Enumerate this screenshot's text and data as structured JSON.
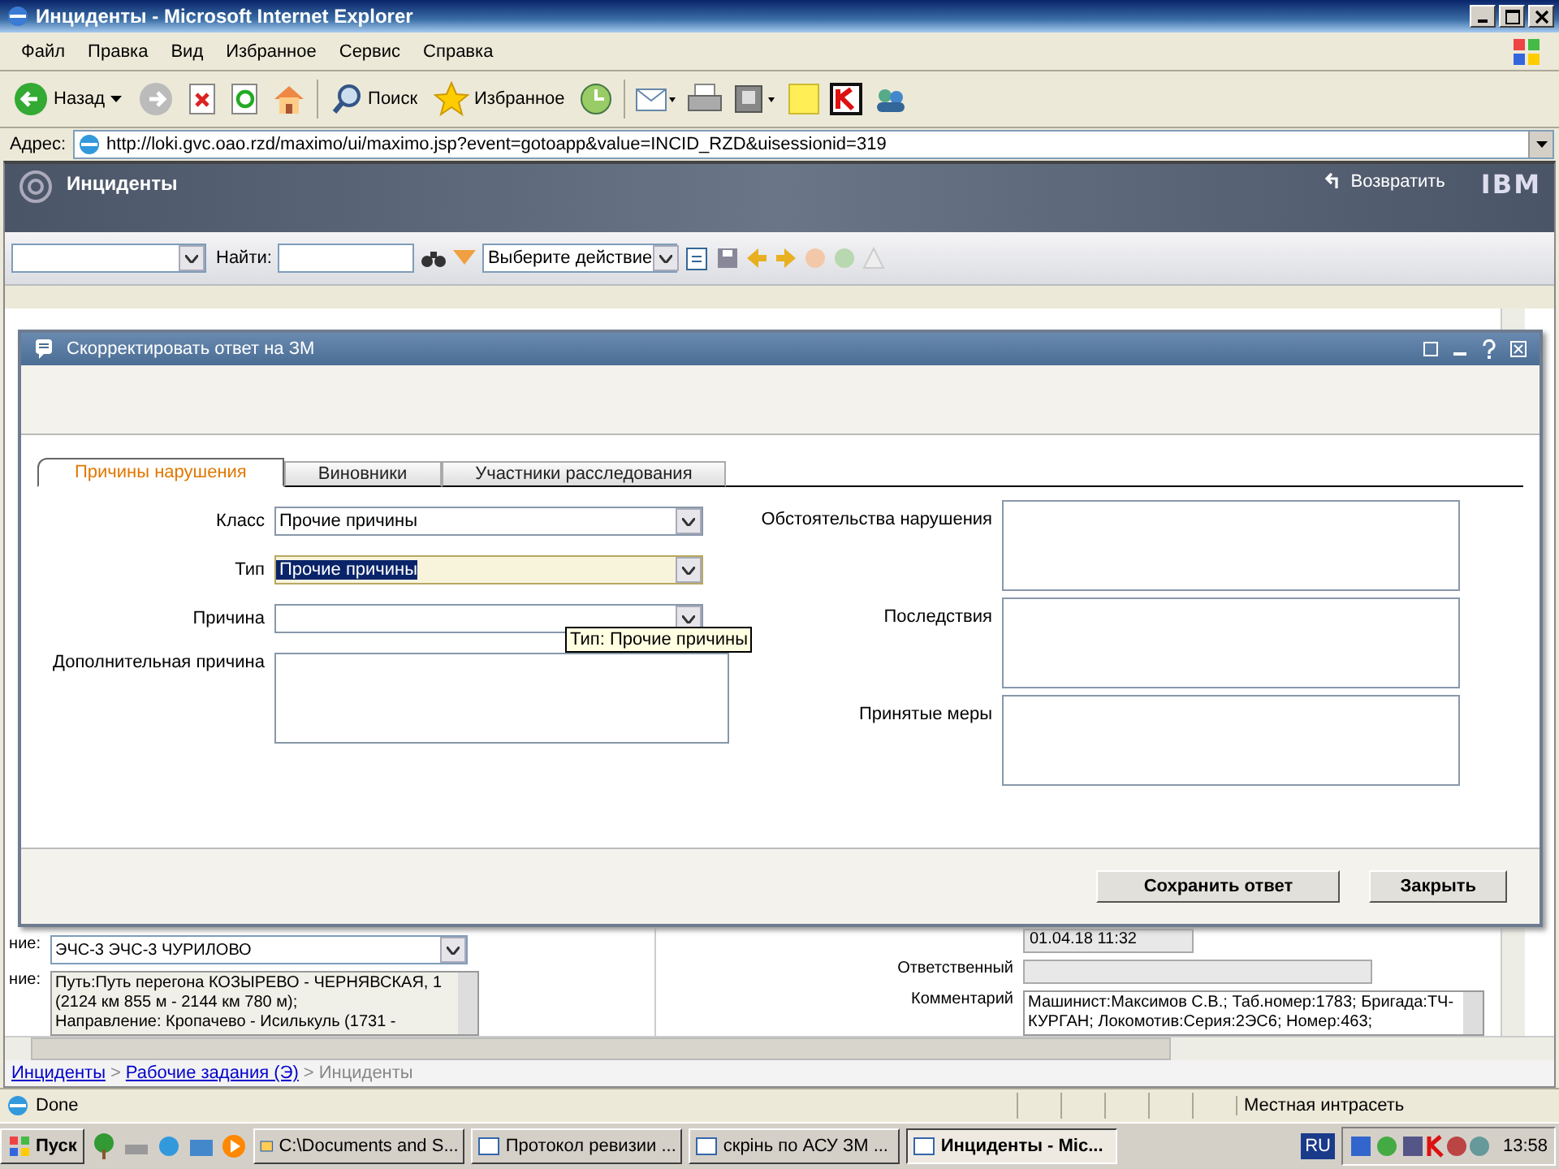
{
  "window": {
    "title": "Инциденты - Microsoft Internet Explorer"
  },
  "menu": [
    "Файл",
    "Правка",
    "Вид",
    "Избранное",
    "Сервис",
    "Справка"
  ],
  "toolbar": {
    "back": "Назад",
    "search": "Поиск",
    "favorites": "Избранное"
  },
  "address": {
    "label": "Адрес:",
    "url": "http://loki.gvc.oao.rzd/maximo/ui/maximo.jsp?event=gotoapp&value=INCID_RZD&uisessionid=319"
  },
  "app": {
    "title": "Инциденты",
    "return_link": "Возвратить",
    "logo": "IBM",
    "find_label": "Найти:",
    "action_select": "Выберите действие"
  },
  "dialog": {
    "title": "Скорректировать ответ на ЗМ",
    "tabs": [
      {
        "label": "Причины нарушения",
        "selected": true
      },
      {
        "label": "Виновники",
        "selected": false
      },
      {
        "label": "Участники расследования",
        "selected": false
      }
    ],
    "left_fields": [
      {
        "label": "Класс",
        "kind": "select",
        "value": "Прочие причины",
        "highlighted": false
      },
      {
        "label": "Тип",
        "kind": "select",
        "value": "Прочие причины",
        "highlighted": true
      },
      {
        "label": "Причина",
        "kind": "select",
        "highlighted": false
      },
      {
        "label": "Дополнительная причина",
        "kind": "textarea"
      }
    ],
    "right_fields": [
      {
        "label": "Обстоятельства нарушения"
      },
      {
        "label": "Последствия"
      },
      {
        "label": "Принятые меры"
      }
    ],
    "tooltip": "Тип: Прочие причины",
    "buttons": [
      "Сохранить ответ",
      "Закрыть"
    ]
  },
  "background": {
    "left": [
      {
        "label": "ние:",
        "kind": "select",
        "value": "ЭЧС-3 ЭЧС-3 ЧУРИЛОВО"
      },
      {
        "label": "ние:",
        "kind": "textarea",
        "lines": [
          "Путь:Путь перегона КОЗЫРЕВО - ЧЕРНЯВСКАЯ, 1",
          "(2124 км 855 м - 2144 км 780 м);",
          "Направление: Кропачево - Исилькуль (1731 -"
        ]
      }
    ],
    "right": [
      {
        "kind": "readonly",
        "value": "01.04.18 11:32"
      },
      {
        "label": "Ответственный",
        "kind": "readonly"
      },
      {
        "label": "Комментарий",
        "kind": "textarea",
        "lines": [
          "Машинист:Максимов С.В.; Таб.номер:1783; Бригада:ТЧ-",
          "КУРГАН; Локомотив:Серия:2ЭС6; Номер:463;"
        ]
      }
    ]
  },
  "breadcrumb": {
    "separator": ">",
    "items": [
      {
        "label": "Инциденты",
        "link": true
      },
      {
        "label": "Рабочие задания (Э)",
        "link": true
      },
      {
        "label": "Инциденты",
        "link": false
      }
    ]
  },
  "status_bar": {
    "text": "Done",
    "zone": "Местная интрасеть"
  },
  "taskbar": {
    "start": "Пуск",
    "tasks": [
      {
        "label": "C:\\Documents and S...",
        "selected": false
      },
      {
        "label": "Протокол ревизии ...",
        "selected": false
      },
      {
        "label": "скрінь по АСУ ЗМ ...",
        "selected": false
      },
      {
        "label": "Инциденты - Mic...",
        "selected": true
      }
    ],
    "language": "RU",
    "clock": "13:58"
  }
}
